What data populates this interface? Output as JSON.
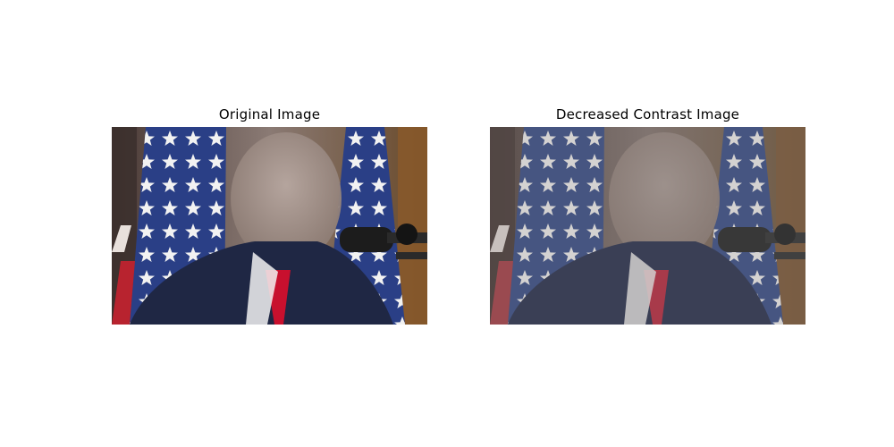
{
  "panels": [
    {
      "title": "Original Image",
      "contrast": 1.0
    },
    {
      "title": "Decreased Contrast Image",
      "contrast": 0.55
    }
  ],
  "colors": {
    "background": "#ffffff",
    "flag_blue": "#2a3f86",
    "flag_red": "#b8232f",
    "suit": "#1f2744",
    "tie": "#c8102e",
    "curtain": "#6e5a52"
  },
  "content_note_icons": [
    "flag-icon",
    "microphone-icon"
  ]
}
